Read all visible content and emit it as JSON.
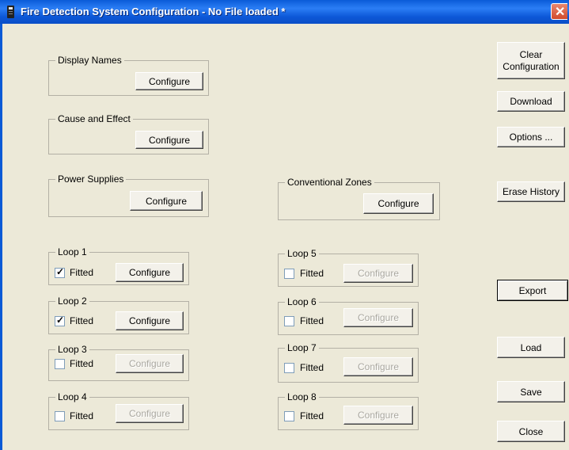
{
  "window": {
    "title": "Fire Detection System Configuration - No File loaded *",
    "close_glyph": "✕"
  },
  "groups": {
    "display_names": {
      "label": "Display Names",
      "button": "Configure"
    },
    "cause_effect": {
      "label": "Cause and Effect",
      "button": "Configure"
    },
    "power_supplies": {
      "label": "Power Supplies",
      "button": "Configure"
    },
    "conventional_zones": {
      "label": "Conventional Zones",
      "button": "Configure"
    }
  },
  "loops": [
    {
      "label": "Loop 1",
      "fitted_label": "Fitted",
      "fitted": true,
      "button": "Configure",
      "enabled": true
    },
    {
      "label": "Loop 2",
      "fitted_label": "Fitted",
      "fitted": true,
      "button": "Configure",
      "enabled": true
    },
    {
      "label": "Loop 3",
      "fitted_label": "Fitted",
      "fitted": false,
      "button": "Configure",
      "enabled": false
    },
    {
      "label": "Loop 4",
      "fitted_label": "Fitted",
      "fitted": false,
      "button": "Configure",
      "enabled": false
    },
    {
      "label": "Loop 5",
      "fitted_label": "Fitted",
      "fitted": false,
      "button": "Configure",
      "enabled": false
    },
    {
      "label": "Loop 6",
      "fitted_label": "Fitted",
      "fitted": false,
      "button": "Configure",
      "enabled": false
    },
    {
      "label": "Loop 7",
      "fitted_label": "Fitted",
      "fitted": false,
      "button": "Configure",
      "enabled": false
    },
    {
      "label": "Loop 8",
      "fitted_label": "Fitted",
      "fitted": false,
      "button": "Configure",
      "enabled": false
    }
  ],
  "checkmark": "✓",
  "side_buttons": {
    "clear_line1": "Clear",
    "clear_line2": "Configuration",
    "download": "Download",
    "options": "Options ...",
    "erase_history": "Erase History",
    "export": "Export",
    "load": "Load",
    "save": "Save",
    "close": "Close"
  }
}
